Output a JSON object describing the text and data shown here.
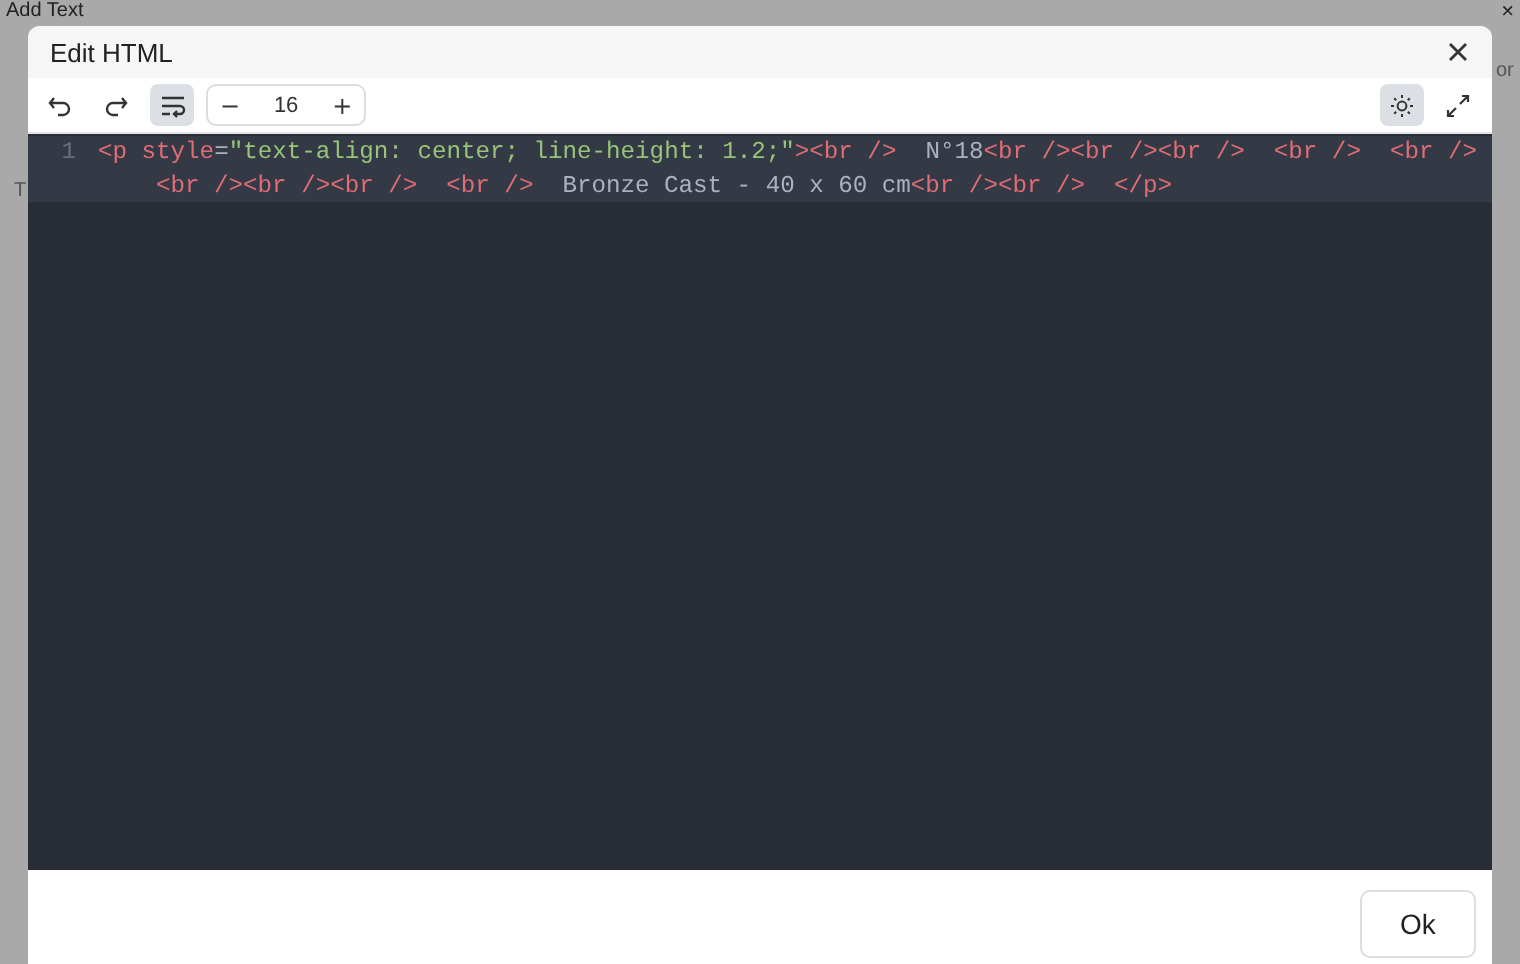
{
  "background": {
    "title": "Add Text",
    "close": "×",
    "fragment_left": "T",
    "fragment_right": "or"
  },
  "dialog": {
    "title": "Edit HTML",
    "toolbar": {
      "wrap_selected": true,
      "font_size": "16",
      "decrease": "−",
      "increase": "+",
      "theme_selected": true
    },
    "editor": {
      "rows": [
        {
          "line_number": "1",
          "active": true,
          "indent": false,
          "tokens": [
            {
              "kind": "tag",
              "text": "<p "
            },
            {
              "kind": "attr",
              "text": "style"
            },
            {
              "kind": "punct",
              "text": "="
            },
            {
              "kind": "string",
              "text": "\"text-align: center; line-height: 1.2;\""
            },
            {
              "kind": "tag",
              "text": ">"
            },
            {
              "kind": "tag",
              "text": "<br />"
            },
            {
              "kind": "text",
              "text": "  N°18"
            },
            {
              "kind": "tag",
              "text": "<br />"
            },
            {
              "kind": "tag",
              "text": "<br />"
            },
            {
              "kind": "tag",
              "text": "<br />"
            },
            {
              "kind": "tag",
              "text": "  <br />"
            },
            {
              "kind": "tag",
              "text": "  <br />"
            }
          ]
        },
        {
          "active": true,
          "indent": true,
          "tokens": [
            {
              "kind": "tag",
              "text": "<br />"
            },
            {
              "kind": "tag",
              "text": "<br />"
            },
            {
              "kind": "tag",
              "text": "<br />"
            },
            {
              "kind": "tag",
              "text": "  <br />"
            },
            {
              "kind": "text",
              "text": "  Bronze Cast - 40 x 60 cm"
            },
            {
              "kind": "tag",
              "text": "<br />"
            },
            {
              "kind": "tag",
              "text": "<br />"
            },
            {
              "kind": "tag",
              "text": "  </p>"
            }
          ]
        }
      ]
    },
    "ok_button": "Ok"
  }
}
